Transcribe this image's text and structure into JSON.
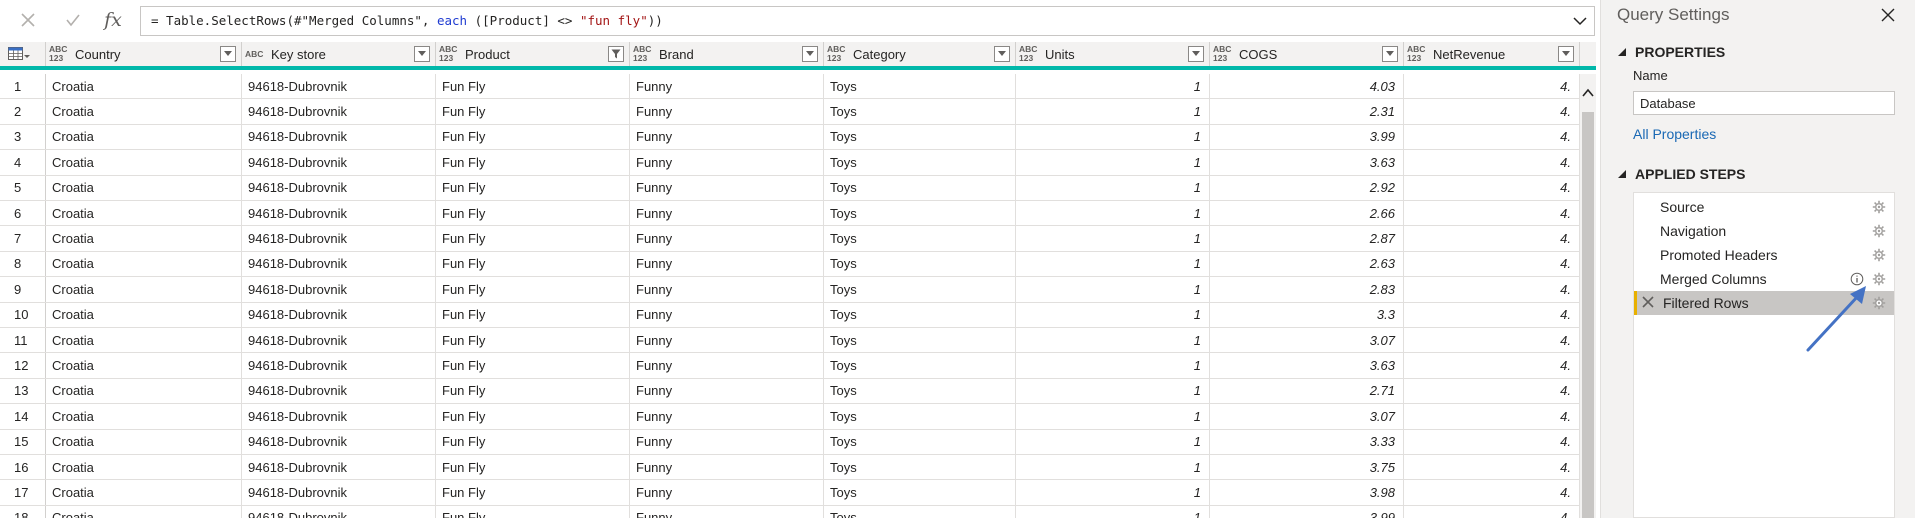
{
  "formula": {
    "prefix": "= Table.SelectRows(#\"Merged Columns\", ",
    "keyword": "each",
    "middle": " ([Product] <> ",
    "string": "\"fun fly\"",
    "suffix": "))",
    "cancel_icon": "close-icon",
    "commit_icon": "check-icon",
    "fx_label": "fx"
  },
  "columns": [
    {
      "name": "Country",
      "type": "ABC\n123",
      "filtered": false
    },
    {
      "name": "Key store",
      "type": "ABC",
      "filtered": false
    },
    {
      "name": "Product",
      "type": "ABC\n123",
      "filtered": true
    },
    {
      "name": "Brand",
      "type": "ABC\n123",
      "filtered": false
    },
    {
      "name": "Category",
      "type": "ABC\n123",
      "filtered": false
    },
    {
      "name": "Units",
      "type": "ABC\n123",
      "filtered": false
    },
    {
      "name": "COGS",
      "type": "ABC\n123",
      "filtered": false
    },
    {
      "name": "NetRevenue",
      "type": "ABC\n123",
      "filtered": false
    }
  ],
  "rows": [
    {
      "n": "1",
      "cells": [
        "Croatia",
        "94618-Dubrovnik",
        "Fun Fly",
        "Funny",
        "Toys",
        "1",
        "4.03",
        "4."
      ]
    },
    {
      "n": "2",
      "cells": [
        "Croatia",
        "94618-Dubrovnik",
        "Fun Fly",
        "Funny",
        "Toys",
        "1",
        "2.31",
        "4."
      ]
    },
    {
      "n": "3",
      "cells": [
        "Croatia",
        "94618-Dubrovnik",
        "Fun Fly",
        "Funny",
        "Toys",
        "1",
        "3.99",
        "4."
      ]
    },
    {
      "n": "4",
      "cells": [
        "Croatia",
        "94618-Dubrovnik",
        "Fun Fly",
        "Funny",
        "Toys",
        "1",
        "3.63",
        "4."
      ]
    },
    {
      "n": "5",
      "cells": [
        "Croatia",
        "94618-Dubrovnik",
        "Fun Fly",
        "Funny",
        "Toys",
        "1",
        "2.92",
        "4."
      ]
    },
    {
      "n": "6",
      "cells": [
        "Croatia",
        "94618-Dubrovnik",
        "Fun Fly",
        "Funny",
        "Toys",
        "1",
        "2.66",
        "4."
      ]
    },
    {
      "n": "7",
      "cells": [
        "Croatia",
        "94618-Dubrovnik",
        "Fun Fly",
        "Funny",
        "Toys",
        "1",
        "2.87",
        "4."
      ]
    },
    {
      "n": "8",
      "cells": [
        "Croatia",
        "94618-Dubrovnik",
        "Fun Fly",
        "Funny",
        "Toys",
        "1",
        "2.63",
        "4."
      ]
    },
    {
      "n": "9",
      "cells": [
        "Croatia",
        "94618-Dubrovnik",
        "Fun Fly",
        "Funny",
        "Toys",
        "1",
        "2.83",
        "4."
      ]
    },
    {
      "n": "10",
      "cells": [
        "Croatia",
        "94618-Dubrovnik",
        "Fun Fly",
        "Funny",
        "Toys",
        "1",
        "3.3",
        "4."
      ]
    },
    {
      "n": "11",
      "cells": [
        "Croatia",
        "94618-Dubrovnik",
        "Fun Fly",
        "Funny",
        "Toys",
        "1",
        "3.07",
        "4."
      ]
    },
    {
      "n": "12",
      "cells": [
        "Croatia",
        "94618-Dubrovnik",
        "Fun Fly",
        "Funny",
        "Toys",
        "1",
        "3.63",
        "4."
      ]
    },
    {
      "n": "13",
      "cells": [
        "Croatia",
        "94618-Dubrovnik",
        "Fun Fly",
        "Funny",
        "Toys",
        "1",
        "2.71",
        "4."
      ]
    },
    {
      "n": "14",
      "cells": [
        "Croatia",
        "94618-Dubrovnik",
        "Fun Fly",
        "Funny",
        "Toys",
        "1",
        "3.07",
        "4."
      ]
    },
    {
      "n": "15",
      "cells": [
        "Croatia",
        "94618-Dubrovnik",
        "Fun Fly",
        "Funny",
        "Toys",
        "1",
        "3.33",
        "4."
      ]
    },
    {
      "n": "16",
      "cells": [
        "Croatia",
        "94618-Dubrovnik",
        "Fun Fly",
        "Funny",
        "Toys",
        "1",
        "3.75",
        "4."
      ]
    },
    {
      "n": "17",
      "cells": [
        "Croatia",
        "94618-Dubrovnik",
        "Fun Fly",
        "Funny",
        "Toys",
        "1",
        "3.98",
        "4."
      ]
    },
    {
      "n": "18",
      "cells": [
        "Croatia",
        "94618-Dubrovnik",
        "Fun Fly",
        "Funny",
        "Toys",
        "1",
        "3.99",
        "4."
      ]
    }
  ],
  "query_settings": {
    "title": "Query Settings",
    "properties_header": "PROPERTIES",
    "name_label": "Name",
    "name_value": "Database",
    "all_properties": "All Properties",
    "applied_steps_header": "APPLIED STEPS",
    "steps": [
      {
        "label": "Source",
        "active": false,
        "info": false
      },
      {
        "label": "Navigation",
        "active": false,
        "info": false
      },
      {
        "label": "Promoted Headers",
        "active": false,
        "info": false
      },
      {
        "label": "Merged Columns",
        "active": false,
        "info": true
      },
      {
        "label": "Filtered Rows",
        "active": true,
        "info": false
      }
    ]
  },
  "colors": {
    "accent_teal": "#01b8aa",
    "link_blue": "#1968b4",
    "active_step_marker": "#e8b000",
    "annotation_arrow": "#4472c4"
  }
}
